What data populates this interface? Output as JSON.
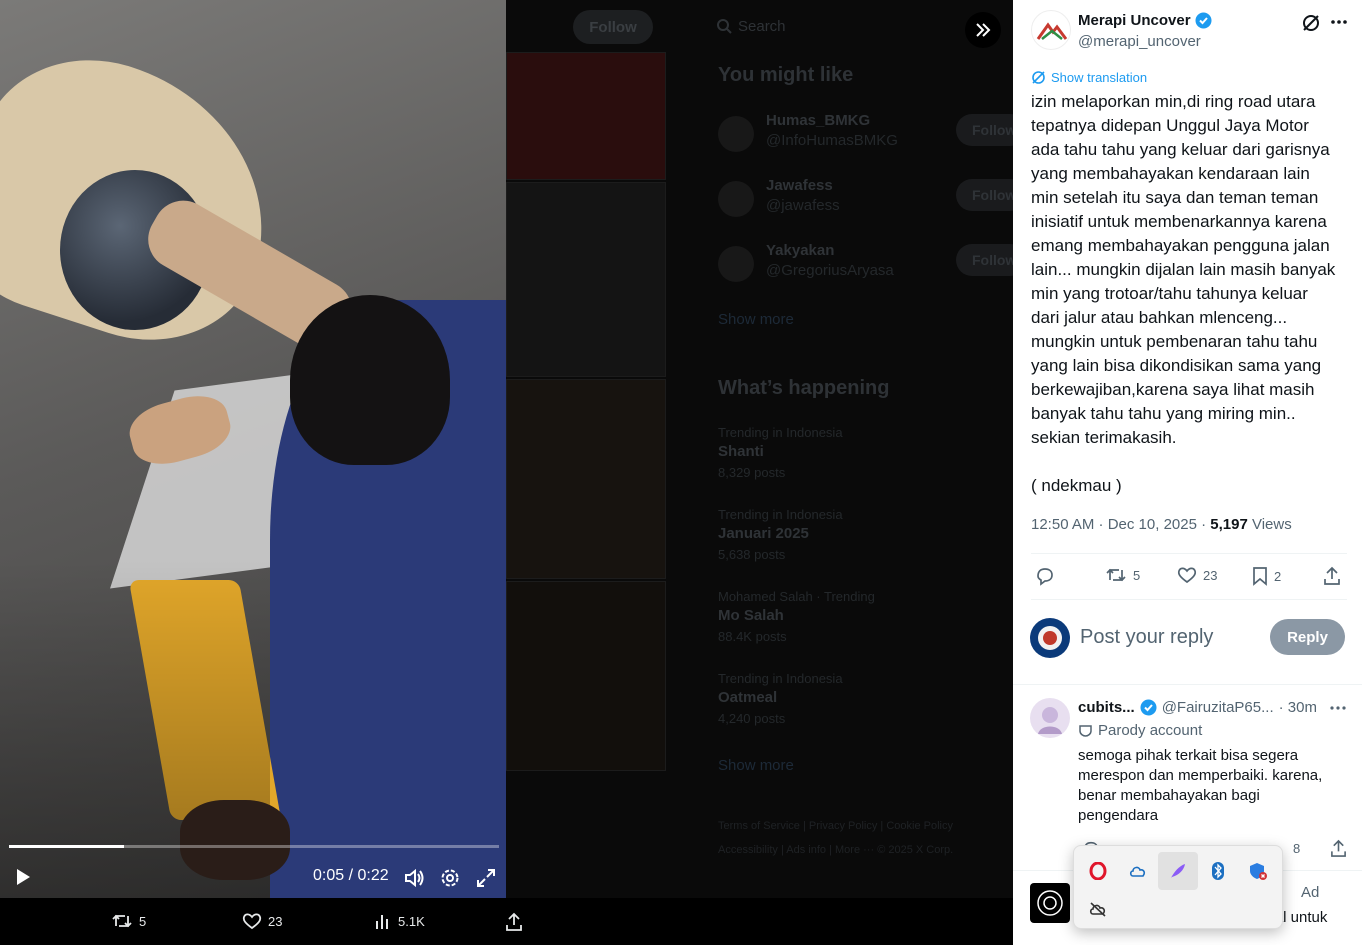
{
  "video": {
    "time": "0:05 / 0:22",
    "progress_fraction": 0.235
  },
  "video_actions": {
    "retweets": "5",
    "likes": "23",
    "views": "5.1K"
  },
  "background": {
    "follow_label": "Follow",
    "search_placeholder": "Search",
    "you_might_like": "You might like",
    "suggestions": [
      {
        "name": "Humas_BMKG",
        "handle": "@InfoHumasBMKG",
        "follow": "Follow"
      },
      {
        "name": "Jawafess",
        "handle": "@jawafess",
        "follow": "Follow"
      },
      {
        "name": "Yakyakan",
        "handle": "@GregoriusAryasa",
        "follow": "Follow"
      }
    ],
    "show_more": "Show more",
    "whats_happening": "What’s happening",
    "trends": [
      {
        "context": "Trending in Indonesia",
        "title": "Shanti",
        "posts": "8,329 posts"
      },
      {
        "context": "Trending in Indonesia",
        "title": "Januari 2025",
        "posts": "5,638 posts"
      },
      {
        "context": "Mohamed Salah · Trending",
        "title": "Mo Salah",
        "posts": "88.4K posts"
      },
      {
        "context": "Trending in Indonesia",
        "title": "Oatmeal",
        "posts": "4,240 posts"
      }
    ],
    "show_more_2": "Show more",
    "footer": [
      "Terms of Service",
      "Privacy Policy",
      "Cookie Policy",
      "Accessibility",
      "Ads info",
      "More ···",
      "© 2025 X Corp."
    ]
  },
  "post": {
    "author_name": "Merapi Uncover",
    "author_handle": "@merapi_uncover",
    "show_translation": "Show translation",
    "text": "izin melaporkan min,di ring road utara\ntepatnya didepan Unggul Jaya Motor\nada tahu tahu yang keluar dari garisnya\nyang membahayakan kendaraan lain\nmin setelah itu saya dan teman teman\ninisiatif untuk membenarkannya karena\nemang membahayakan pengguna jalan\nlain... mungkin dijalan lain masih banyak\nmin yang trotoar/tahu tahunya keluar\ndari jalur atau bahkan mlenceng...\nmungkin untuk pembenaran tahu tahu\nyang lain bisa dikondisikan sama yang\nberkewajiban,karena saya lihat masih\nbanyak tahu tahu yang miring min..\nsekian terimakasih.\n\n( ndekmau )",
    "timestamp": "12:50 AM · Dec 10, 2025 · ",
    "views_count": "5,197",
    "views_label": " Views",
    "retweets": "5",
    "likes": "23",
    "bookmarks": "2"
  },
  "reply_box": {
    "placeholder": "Post your reply",
    "button": "Reply"
  },
  "reply": {
    "name": "cubits...",
    "handle": "@FairuzitaP65...",
    "time": "· 30m",
    "parody": "Parody account",
    "text": "semoga pihak terkait bisa segera\nmerespon dan memperbaiki. karena,\nbenar membahayakan bagi\npengendara",
    "views": "8"
  },
  "ad": {
    "label": "Ad",
    "text": "berkecepatan tinggi yang andal untuk"
  },
  "colors": {
    "accent": "#1d9bf0",
    "verified": "#1d9bf0",
    "reply_button": "#8b98a5"
  }
}
